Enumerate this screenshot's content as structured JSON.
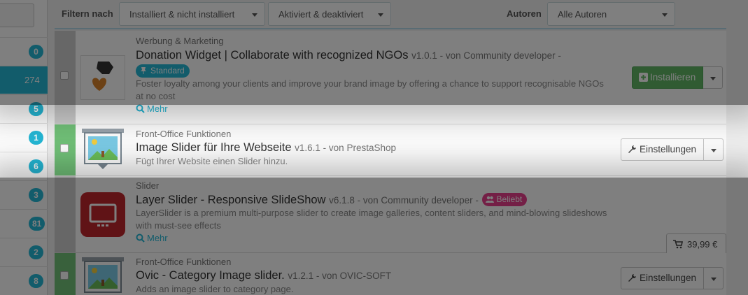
{
  "sidebar": {
    "counts": [
      "0",
      "274",
      "5",
      "1",
      "6",
      "3",
      "81",
      "2",
      "8"
    ]
  },
  "filters": {
    "label": "Filtern nach",
    "install_filter": "Installiert & nicht installiert",
    "status_filter": "Aktiviert & deaktiviert",
    "authors_label": "Autoren",
    "authors_filter": "Alle Autoren"
  },
  "modules": [
    {
      "category": "Werbung & Marketing",
      "name": "Donation Widget | Collaborate with recognized NGOs",
      "meta": "v1.0.1 - von Community developer -",
      "badge": "Standard",
      "description": "Foster loyalty among your clients and improve your brand image by offering a chance to support recognisable NGOs at no cost",
      "more": "Mehr",
      "action": "Installieren"
    },
    {
      "category": "Front-Office Funktionen",
      "name": "Image Slider für Ihre Webseite",
      "meta": "v1.6.1 - von PrestaShop",
      "description": "Fügt Ihrer Website einen Slider hinzu.",
      "action": "Einstellungen"
    },
    {
      "category": "Slider",
      "name": "Layer Slider - Responsive SlideShow",
      "meta": "v6.1.8 - von Community developer -",
      "badge": "Beliebt",
      "description": "LayerSlider is a premium multi-purpose slider to create image galleries, content sliders, and mind-blowing slideshows with must-see effects",
      "more": "Mehr",
      "price": "39,99 €"
    },
    {
      "category": "Front-Office Funktionen",
      "name": "Ovic - Category Image slider.",
      "meta": "v1.2.1 - von OVIC-SOFT",
      "description": "Adds an image slider to category page.",
      "action": "Einstellungen"
    }
  ],
  "colors": {
    "accent": "#25b9d7",
    "install_green": "#60b765",
    "popular_pink": "#e83e8c",
    "enabled_stripe": "#72c279"
  }
}
